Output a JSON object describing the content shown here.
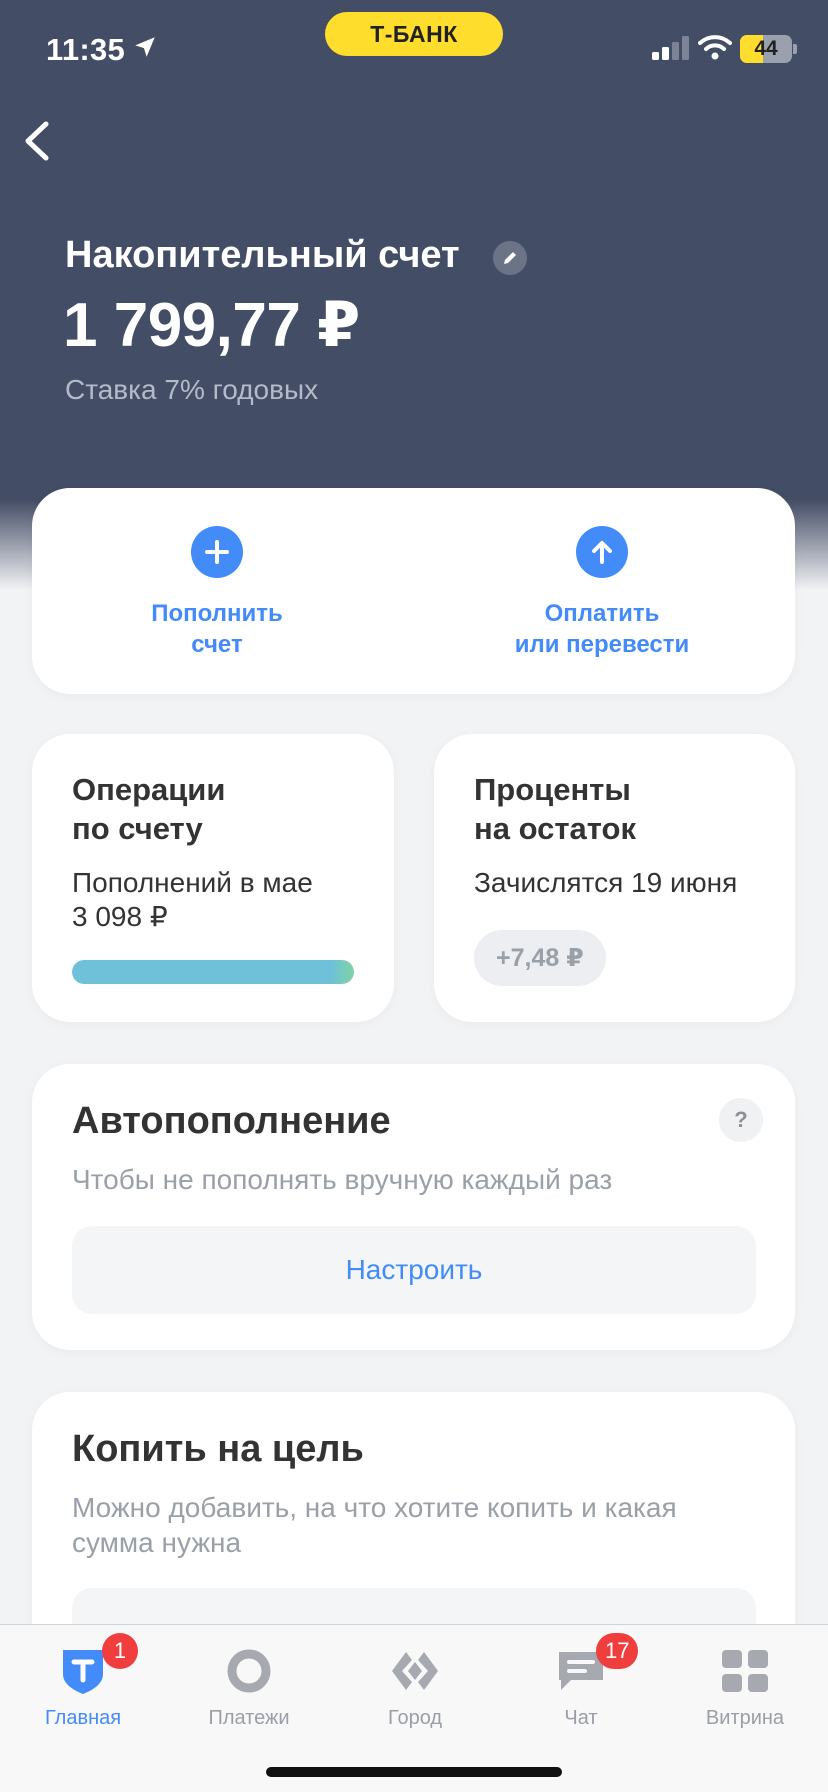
{
  "status_bar": {
    "time": "11:35",
    "bank_label": "Т-БАНК",
    "battery_level": "44",
    "battery_percent": 44
  },
  "account": {
    "title": "Накопительный счет",
    "balance": "1 799,77 ₽",
    "rate": "Ставка 7% годовых"
  },
  "actions": {
    "top_up": "Пополнить\nсчет",
    "pay": "Оплатить\nили перевести"
  },
  "operations": {
    "title": "Операции\nпо счету",
    "subtitle": "Пополнений в мае\n3 098 ₽",
    "progress_fraction": 1.0
  },
  "interest": {
    "title": "Проценты\nна остаток",
    "subtitle": "Зачислятся 19 июня",
    "amount": "+7,48 ₽"
  },
  "autofill": {
    "title": "Автопополнение",
    "help": "?",
    "description": "Чтобы не пополнять вручную каждый раз",
    "button": "Настроить"
  },
  "goal": {
    "title": "Копить на цель",
    "description": "Можно добавить, на что хотите копить и какая сумма нужна"
  },
  "tabs": [
    {
      "label": "Главная",
      "icon": "tbank-shield-icon",
      "badge": "1",
      "active": true
    },
    {
      "label": "Платежи",
      "icon": "payments-circle-icon",
      "badge": "",
      "active": false
    },
    {
      "label": "Город",
      "icon": "city-icon",
      "badge": "",
      "active": false
    },
    {
      "label": "Чат",
      "icon": "chat-icon",
      "badge": "17",
      "active": false
    },
    {
      "label": "Витрина",
      "icon": "showcase-grid-icon",
      "badge": "",
      "active": false
    }
  ],
  "colors": {
    "header_bg": "#444d66",
    "accent": "#428bf9",
    "bank_yellow": "#ffdd2d",
    "badge_red": "#f03d3e"
  }
}
